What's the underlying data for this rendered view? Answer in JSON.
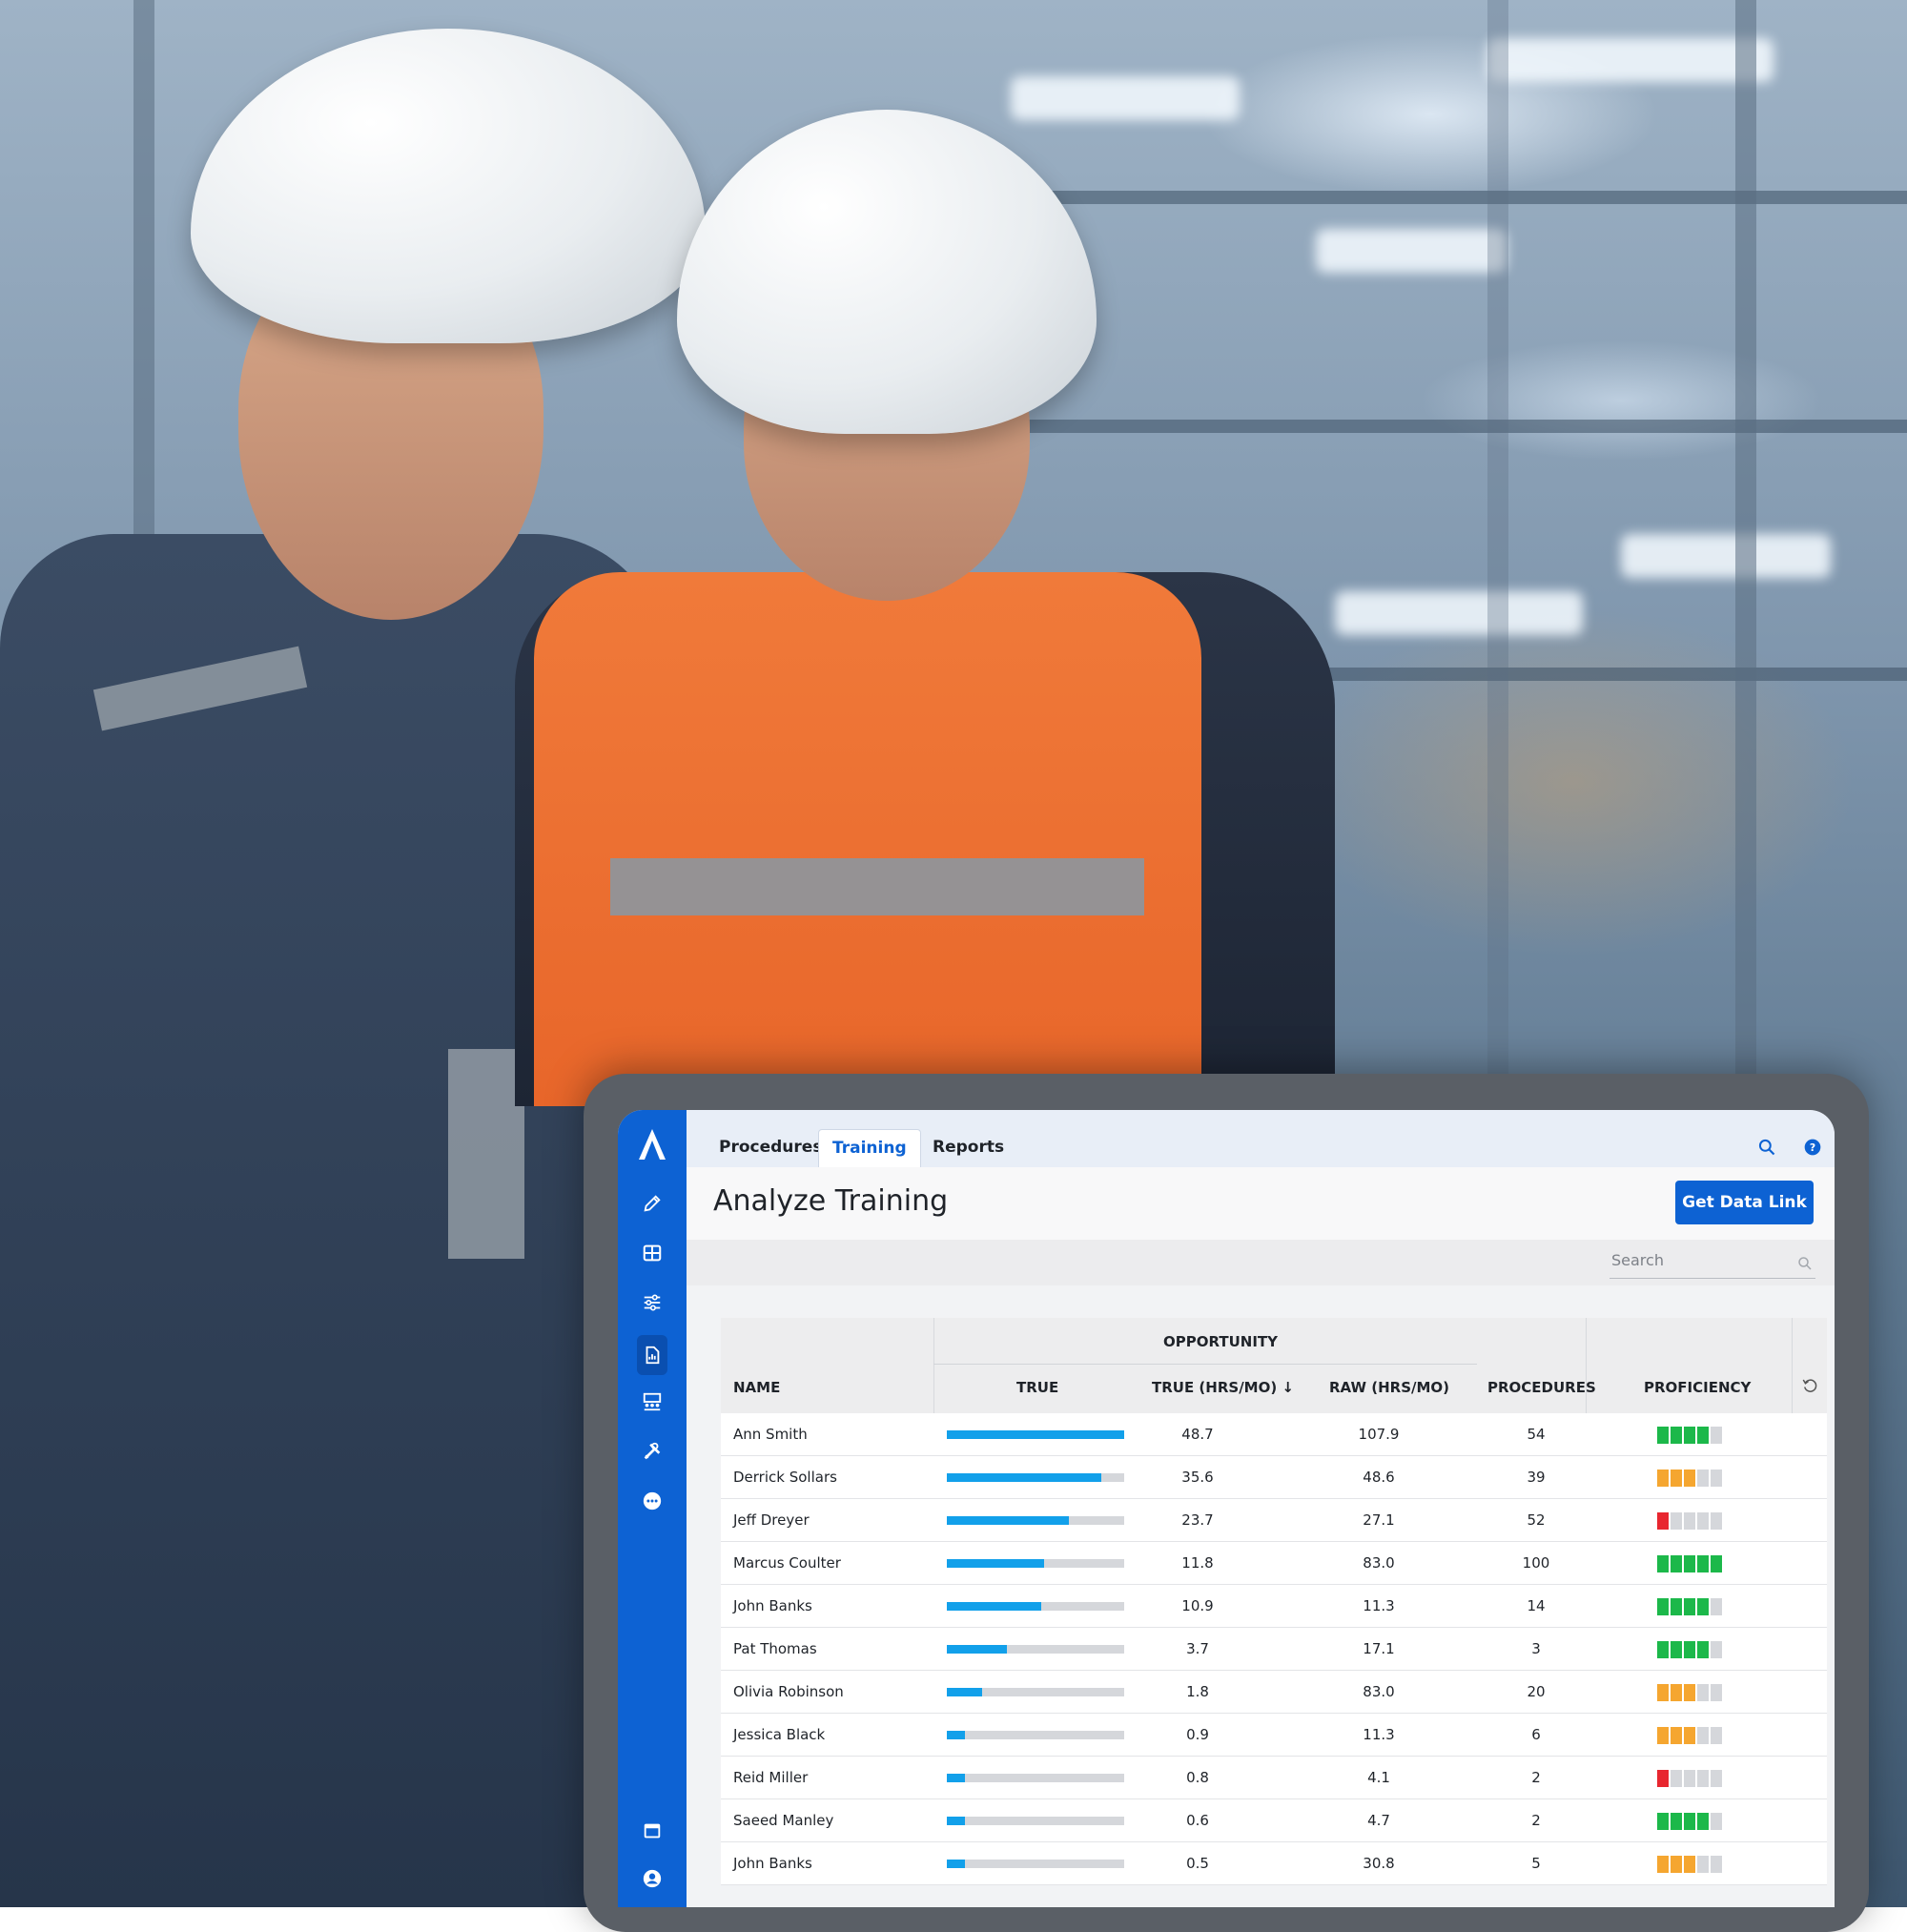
{
  "tabs": [
    {
      "label": "Procedures",
      "active": false
    },
    {
      "label": "Training",
      "active": true
    },
    {
      "label": "Reports",
      "active": false
    }
  ],
  "page": {
    "title": "Analyze Training",
    "primary_button": "Get Data Link",
    "search_placeholder": "Search"
  },
  "sidebar_icons": [
    "pencil-icon",
    "table-icon",
    "sliders-icon",
    "report-icon",
    "classroom-icon",
    "tools-icon",
    "more-icon",
    "window-icon",
    "user-icon"
  ],
  "colors": {
    "brand": "#0d62d3",
    "bar": "#12a0ea",
    "prof_green": "#1cb84a",
    "prof_orange": "#f5a630",
    "prof_red": "#e8262f",
    "prof_empty": "#d5d7db"
  },
  "table": {
    "group_header": "OPPORTUNITY",
    "columns": {
      "name": "NAME",
      "true": "TRUE",
      "true_hrs": "TRUE (HRS/MO) ↓",
      "raw_hrs": "RAW (HRS/MO)",
      "procedures": "PROCEDURES",
      "proficiency": "PROFICIENCY"
    },
    "rows": [
      {
        "name": "Ann Smith",
        "true_hrs": "48.7",
        "raw_hrs": "107.9",
        "procedures": "54",
        "bar": 1.0,
        "prof": 4,
        "prof_color": "green"
      },
      {
        "name": "Derrick Sollars",
        "true_hrs": "35.6",
        "raw_hrs": "48.6",
        "procedures": "39",
        "bar": 0.87,
        "prof": 3,
        "prof_color": "orange"
      },
      {
        "name": "Jeff Dreyer",
        "true_hrs": "23.7",
        "raw_hrs": "27.1",
        "procedures": "52",
        "bar": 0.69,
        "prof": 1,
        "prof_color": "red"
      },
      {
        "name": "Marcus Coulter",
        "true_hrs": "11.8",
        "raw_hrs": "83.0",
        "procedures": "100",
        "bar": 0.55,
        "prof": 5,
        "prof_color": "green"
      },
      {
        "name": "John Banks",
        "true_hrs": "10.9",
        "raw_hrs": "11.3",
        "procedures": "14",
        "bar": 0.53,
        "prof": 4,
        "prof_color": "green"
      },
      {
        "name": "Pat Thomas",
        "true_hrs": "3.7",
        "raw_hrs": "17.1",
        "procedures": "3",
        "bar": 0.34,
        "prof": 4,
        "prof_color": "green"
      },
      {
        "name": "Olivia Robinson",
        "true_hrs": "1.8",
        "raw_hrs": "83.0",
        "procedures": "20",
        "bar": 0.2,
        "prof": 3,
        "prof_color": "orange"
      },
      {
        "name": "Jessica Black",
        "true_hrs": "0.9",
        "raw_hrs": "11.3",
        "procedures": "6",
        "bar": 0.1,
        "prof": 3,
        "prof_color": "orange"
      },
      {
        "name": "Reid Miller",
        "true_hrs": "0.8",
        "raw_hrs": "4.1",
        "procedures": "2",
        "bar": 0.1,
        "prof": 1,
        "prof_color": "red"
      },
      {
        "name": "Saeed Manley",
        "true_hrs": "0.6",
        "raw_hrs": "4.7",
        "procedures": "2",
        "bar": 0.1,
        "prof": 4,
        "prof_color": "green"
      },
      {
        "name": "John Banks",
        "true_hrs": "0.5",
        "raw_hrs": "30.8",
        "procedures": "5",
        "bar": 0.1,
        "prof": 3,
        "prof_color": "orange"
      }
    ]
  }
}
